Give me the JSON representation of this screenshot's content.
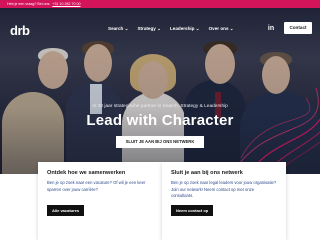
{
  "topbar": {
    "text": "Heb je een vraag? Bel ons:",
    "phone": "+31 10 282 70 00"
  },
  "header": {
    "logo": "drb",
    "nav": [
      {
        "label": "Search ⌄"
      },
      {
        "label": "Strategy ⌄"
      },
      {
        "label": "Leadership ⌄"
      },
      {
        "label": "Over ons ⌄"
      }
    ],
    "linkedin_icon": "in",
    "contact_label": "Contact"
  },
  "hero": {
    "tagline": "Al 30 jaar strategische partner in Search, Strategy & Leadership",
    "headline": "Lead with Character",
    "cta_label": "SLUIT JE AAN BIJ ONS NETWERK",
    "accent_color": "#d4145a"
  },
  "cards": [
    {
      "title": "Ontdek hoe we samenwerken",
      "body": "Ben je op zoek naar een vacature? Of wil je een keer sparren over jouw carrière?",
      "button": "Alle vacatures"
    },
    {
      "title": "Sluit je aan bij ons netwerk",
      "body": "Ben je op zoek naar legal leaders voor jouw organisatie? Join our network! Neem contact op met onze consultants.",
      "button": "Neem contact op"
    }
  ]
}
